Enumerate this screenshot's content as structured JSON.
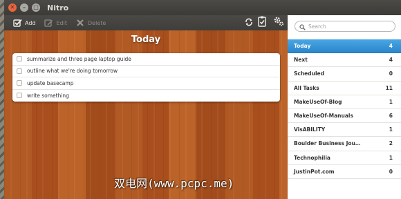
{
  "window": {
    "title": "Nitro"
  },
  "toolbar": {
    "add_label": "Add",
    "edit_label": "Edit",
    "delete_label": "Delete"
  },
  "main": {
    "list_title": "Today",
    "tasks": [
      {
        "text": "summarize and three page laptop guide"
      },
      {
        "text": "outline what we're doing tomorrow"
      },
      {
        "text": "update basecamp"
      },
      {
        "text": "write something"
      }
    ]
  },
  "sidebar": {
    "search_placeholder": "Search",
    "items": [
      {
        "label": "Today",
        "count": "4"
      },
      {
        "label": "Next",
        "count": "4"
      },
      {
        "label": "Scheduled",
        "count": "0"
      },
      {
        "label": "All Tasks",
        "count": "11"
      },
      {
        "label": "MakeUseOf-Blog",
        "count": "1"
      },
      {
        "label": "MakeUseOf-Manuals",
        "count": "6"
      },
      {
        "label": "VisABILITY",
        "count": "1"
      },
      {
        "label": "Boulder Business Jou…",
        "count": "2"
      },
      {
        "label": "Technophilia",
        "count": "1"
      },
      {
        "label": "JustinPot.com",
        "count": "0"
      }
    ]
  },
  "watermark": "双电网(www.pcpc.me)",
  "colors": {
    "accent": "#2f8dd2",
    "close_button": "#e9653b",
    "wood": "#ad5520"
  }
}
